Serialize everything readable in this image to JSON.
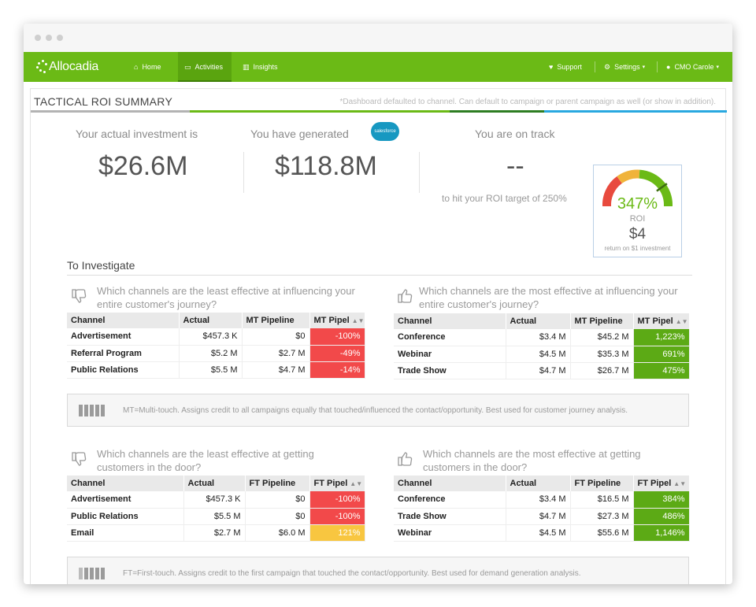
{
  "nav": {
    "logo": "Allocadia",
    "items": [
      {
        "label": "Home",
        "icon": "home-icon"
      },
      {
        "label": "Activities",
        "icon": "monitor-icon"
      },
      {
        "label": "Insights",
        "icon": "bar-chart-icon"
      }
    ],
    "right": [
      {
        "label": "Support",
        "icon": "heart-icon"
      },
      {
        "label": "Settings",
        "icon": "gear-icon"
      },
      {
        "label": "CMO Carole",
        "icon": "user-icon"
      }
    ],
    "caret": "▾"
  },
  "page": {
    "title": "TACTICAL ROI SUMMARY",
    "note": "*Dashboard defaulted to channel. Can default to campaign or parent campaign as well (or show in addition)."
  },
  "kpis": {
    "investment": {
      "label": "Your actual investment is",
      "value": "$26.6M"
    },
    "generated": {
      "label": "You have generated",
      "value": "$118.8M",
      "badge": "salesforce"
    },
    "on_track": {
      "label": "You are on track",
      "value": "--",
      "sub": "to hit your ROI target of 250%"
    }
  },
  "gauge": {
    "percent": "347%",
    "label": "ROI",
    "dollar": "$4",
    "sub": "return on $1 investment",
    "level": 0.78,
    "colors": {
      "red": "#e84a3e",
      "yellow": "#f0b33a",
      "green": "#6bba16"
    }
  },
  "section": {
    "title": "To Investigate"
  },
  "questions": {
    "mt_least": "Which channels are the least effective at influencing your entire customer's journey?",
    "mt_most": "Which channels are the most effective at influencing your entire customer's journey?",
    "ft_least": "Which channels are the least effective at getting customers in the door?",
    "ft_most": "Which channels are the most effective at getting customers in the door?"
  },
  "headers": {
    "channel": "Channel",
    "actual": "Actual",
    "mt_pipeline": "MT Pipeline",
    "mt_pipe_short": "MT Pipel",
    "ft_pipeline": "FT Pipeline",
    "ft_pipe_short": "FT Pipel",
    "sort": "▲▼"
  },
  "tables": {
    "mt_least": [
      {
        "channel": "Advertisement",
        "actual": "$457.3 K",
        "pipeline": "$0",
        "pct": "-100%",
        "color": "#f2494a"
      },
      {
        "channel": "Referral Program",
        "actual": "$5.2 M",
        "pipeline": "$2.7 M",
        "pct": "-49%",
        "color": "#f2494a"
      },
      {
        "channel": "Public Relations",
        "actual": "$5.5 M",
        "pipeline": "$4.7 M",
        "pct": "-14%",
        "color": "#f2494a"
      }
    ],
    "mt_most": [
      {
        "channel": "Conference",
        "actual": "$3.4 M",
        "pipeline": "$45.2 M",
        "pct": "1,223%",
        "color": "#5caa15"
      },
      {
        "channel": "Webinar",
        "actual": "$4.5 M",
        "pipeline": "$35.3 M",
        "pct": "691%",
        "color": "#5caa15"
      },
      {
        "channel": "Trade Show",
        "actual": "$4.7 M",
        "pipeline": "$26.7 M",
        "pct": "475%",
        "color": "#5caa15"
      }
    ],
    "ft_least": [
      {
        "channel": "Advertisement",
        "actual": "$457.3 K",
        "pipeline": "$0",
        "pct": "-100%",
        "color": "#f2494a"
      },
      {
        "channel": "Public Relations",
        "actual": "$5.5 M",
        "pipeline": "$0",
        "pct": "-100%",
        "color": "#f2494a"
      },
      {
        "channel": "Email",
        "actual": "$2.7 M",
        "pipeline": "$6.0 M",
        "pct": "121%",
        "color": "#f8c640"
      }
    ],
    "ft_most": [
      {
        "channel": "Conference",
        "actual": "$3.4 M",
        "pipeline": "$16.5 M",
        "pct": "384%",
        "color": "#5caa15"
      },
      {
        "channel": "Trade Show",
        "actual": "$4.7 M",
        "pipeline": "$27.3 M",
        "pct": "486%",
        "color": "#5caa15"
      },
      {
        "channel": "Webinar",
        "actual": "$4.5 M",
        "pipeline": "$55.6 M",
        "pct": "1,146%",
        "color": "#5caa15"
      }
    ]
  },
  "notes": {
    "mt": "MT=Multi-touch. Assigns credit to all campaigns equally that touched/influenced the contact/opportunity. Best used for customer journey analysis.",
    "ft": "FT=First-touch. Assigns credit to the first campaign that touched the contact/opportunity. Best used for demand generation analysis."
  }
}
